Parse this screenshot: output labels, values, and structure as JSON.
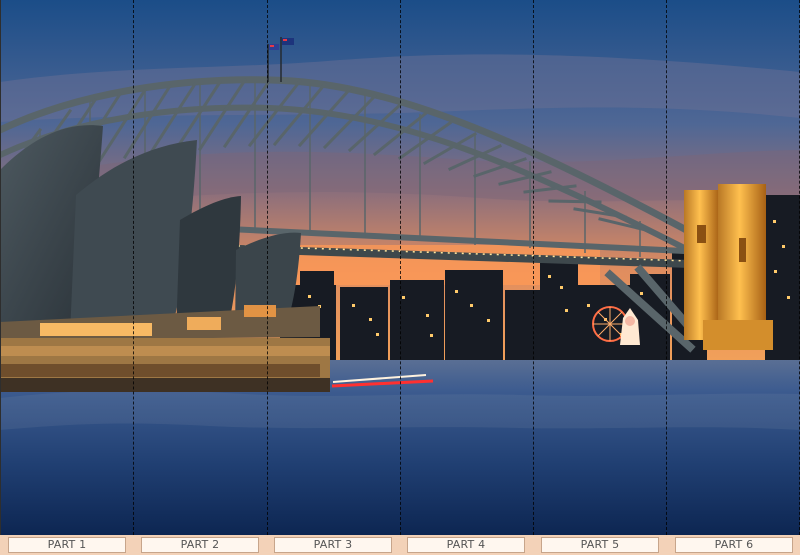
{
  "panels": [
    {
      "label": "PART 1"
    },
    {
      "label": "PART 2"
    },
    {
      "label": "PART 3"
    },
    {
      "label": "PART 4"
    },
    {
      "label": "PART 5"
    },
    {
      "label": "PART 6"
    }
  ],
  "colors": {
    "sky_top": "#1f4f86",
    "sky_mid": "#5c6f9f",
    "sunset": "#f09659",
    "water_top": "#2d4d7c",
    "water_bottom": "#102b59",
    "bridge": "#59656a",
    "opera": "#374148",
    "tower": "#f0b04a",
    "bar_bg": "#f3d2b8"
  }
}
